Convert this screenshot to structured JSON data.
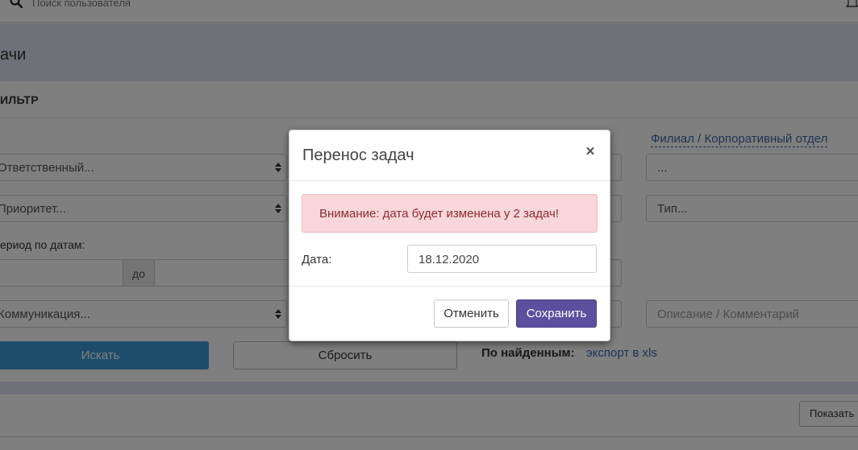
{
  "header": {
    "search_placeholder": "Поиск пользователя"
  },
  "page": {
    "title": "ачи"
  },
  "filter": {
    "title": "ИЛЬТР",
    "responsible_select": "Ответственный...",
    "priority_select": "Приоритет...",
    "period_label": "ериод по датам:",
    "period_to": "до",
    "communication_select": "Коммуникация...",
    "branch_link": "Филиал / Корпоративный отдел",
    "branch_value": "...",
    "type_value": "Тип...",
    "description_placeholder": "Описание / Комментарий",
    "search_button": "Искать",
    "reset_button": "Сбросить",
    "found_label": "По найденным:",
    "export_link": "экспорт в xls"
  },
  "list": {
    "show_button": "Показать"
  },
  "modal": {
    "title": "Перенос задач",
    "close": "×",
    "alert": "Внимание: дата будет изменена у 2 задач!",
    "date_label": "Дата:",
    "date_value": "18.12.2020",
    "cancel_button": "Отменить",
    "save_button": "Сохранить"
  },
  "colors": {
    "primary_button": "#5c4f9e",
    "search_button": "#3a98d6",
    "alert_bg": "#f8d7da",
    "alert_text": "#8e2a32",
    "link": "#3c6aa5"
  }
}
